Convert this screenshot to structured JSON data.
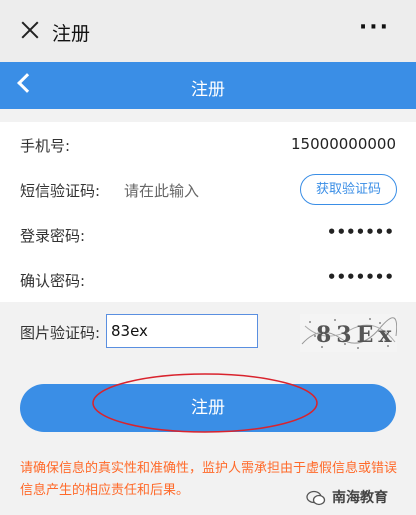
{
  "window": {
    "title": "注册",
    "more_label": "···"
  },
  "nav": {
    "title": "注册"
  },
  "form": {
    "phone_label": "手机号:",
    "phone_value": "15000000000",
    "sms_label": "短信验证码:",
    "sms_placeholder": "请在此输入",
    "get_code_label": "获取验证码",
    "password_label": "登录密码:",
    "password_value": "•••••••",
    "confirm_label": "确认密码:",
    "confirm_value": "•••••••"
  },
  "captcha": {
    "label": "图片验证码:",
    "input_value": "83ex",
    "image_text": "83Ex"
  },
  "submit_label": "注册",
  "notice": "请确保信息的真实性和准确性，监护人需承担由于虚假信息或错误信息产生的相应责任和后果。",
  "brand": {
    "name": "南海教育"
  },
  "colors": {
    "accent": "#3a8ee6",
    "notice": "#ff6a2a",
    "annotation": "#d9232d"
  }
}
